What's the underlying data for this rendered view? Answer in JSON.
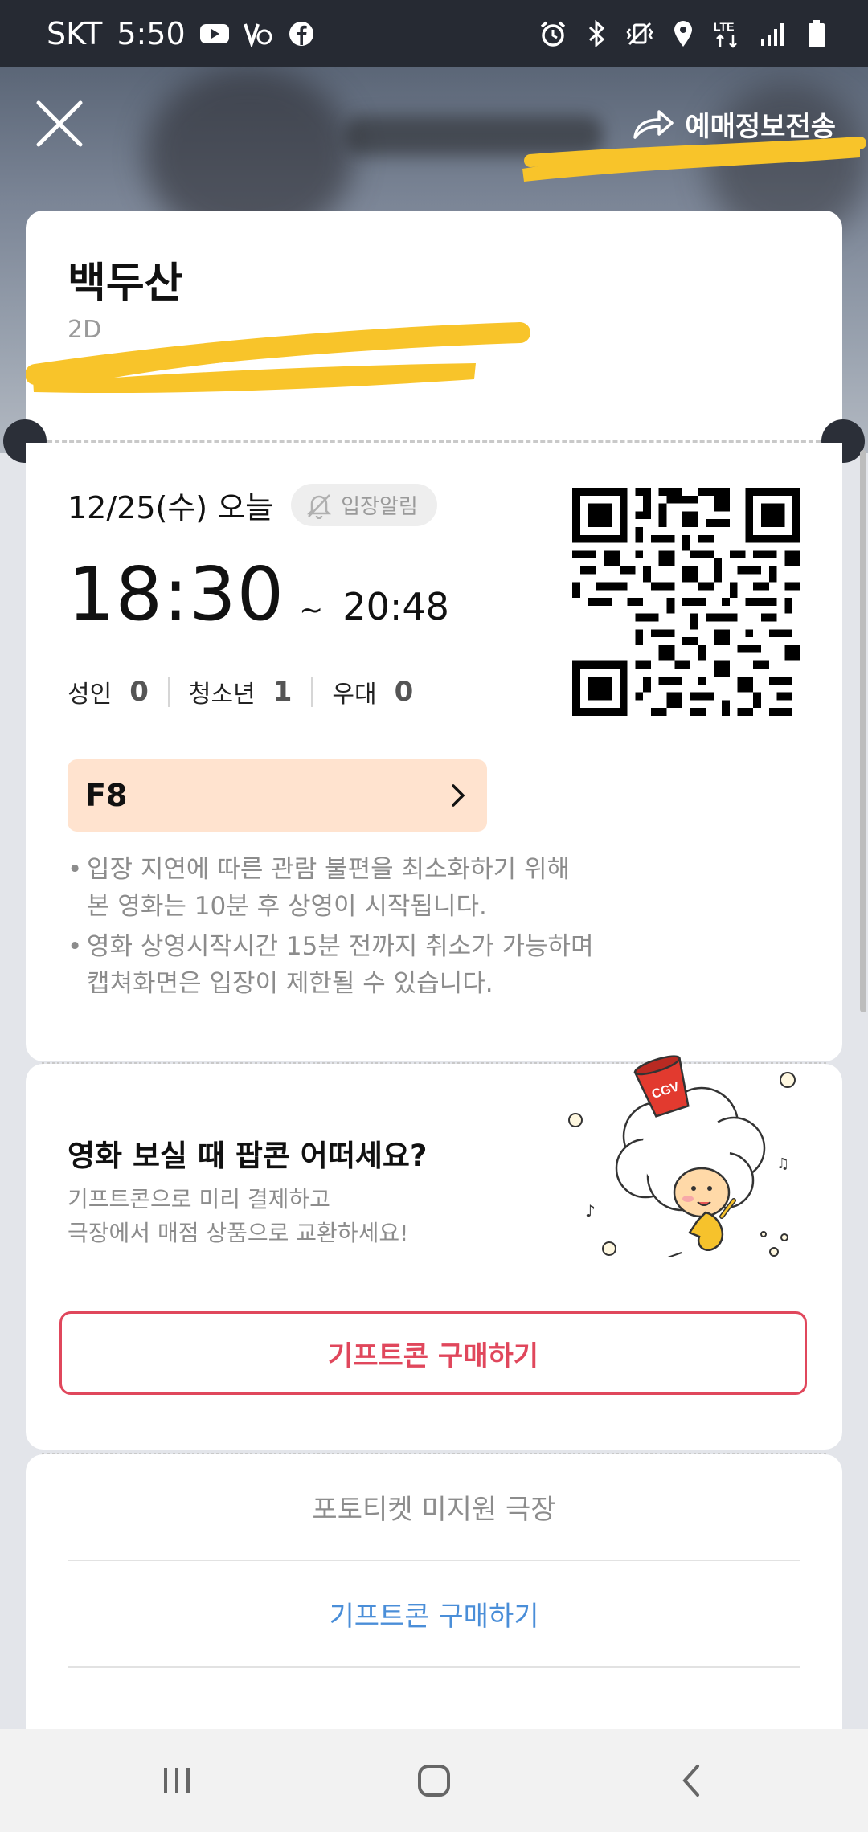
{
  "status_bar": {
    "carrier": "SKT",
    "time": "5:50",
    "left_icons": [
      "youtube-icon",
      "vpn-icon",
      "facebook-icon"
    ],
    "right_icons": [
      "alarm-icon",
      "bluetooth-icon",
      "vibrate-icon",
      "location-icon",
      "lte-icon",
      "signal-icon",
      "battery-icon"
    ],
    "network": "LTE"
  },
  "header": {
    "close_icon": "close-icon",
    "share_label": "예매정보전송",
    "share_icon": "share-arrow-icon"
  },
  "ticket": {
    "title": "백두산",
    "format": "2D",
    "date": "12/25(수) 오늘",
    "alarm_label": "입장알림",
    "start_time": "18:30",
    "tilde": "~",
    "end_time": "20:48",
    "counts": [
      {
        "label": "성인",
        "value": "0"
      },
      {
        "label": "청소년",
        "value": "1"
      },
      {
        "label": "우대",
        "value": "0"
      }
    ],
    "seat": "F8",
    "notes": [
      "입장 지연에 따른 관람 불편을 최소화하기 위해\n본 영화는 10분 후 상영이 시작됩니다.",
      "영화 상영시작시간 15분 전까지 취소가 가능하며\n캡쳐화면은 입장이 제한될 수 있습니다."
    ]
  },
  "popcorn": {
    "title": "영화 보실 때 팝콘 어떠세요?",
    "subtitle": "기프트콘으로 미리 결제하고\n극장에서 매점 상품으로 교환하세요!",
    "buy_label": "기프트콘 구매하기",
    "logo_text": "CGV"
  },
  "bottom": {
    "photo_ticket_label": "포토티켓 미지원 극장",
    "gifticon_label": "기프트콘 구매하기"
  },
  "colors": {
    "accent_red": "#e0475c",
    "seat_bg": "#ffe3cf",
    "link_blue": "#4a8ed8",
    "redaction_yellow": "#f8c42a"
  }
}
